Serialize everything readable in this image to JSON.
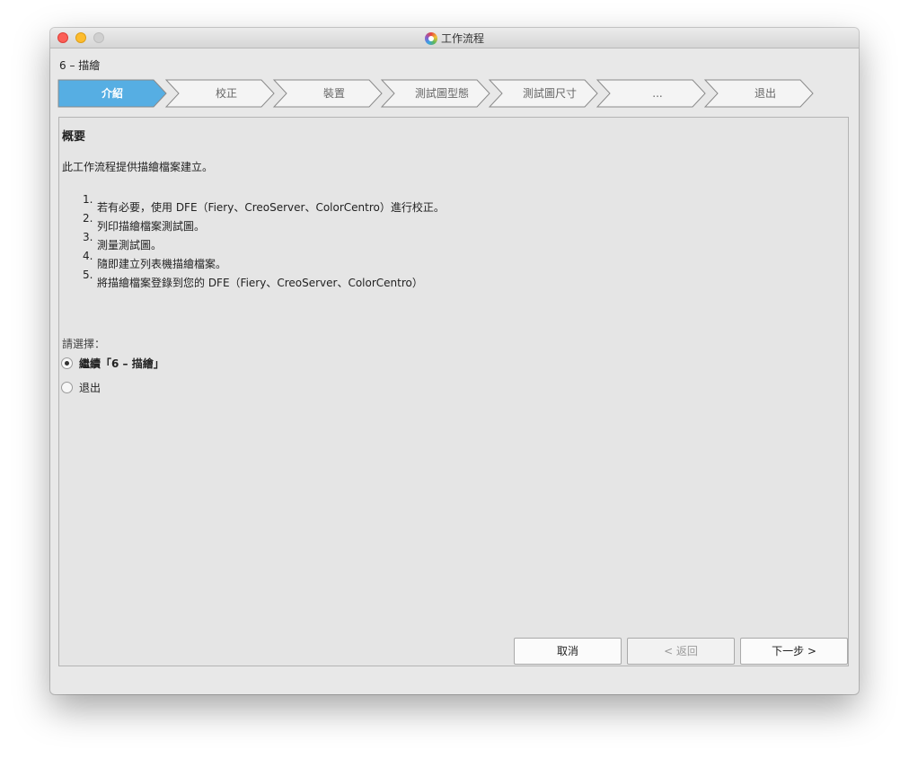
{
  "window": {
    "title": "工作流程"
  },
  "subtitle": "6 – 描繪",
  "steps": [
    {
      "label": "介紹",
      "active": true
    },
    {
      "label": "校正",
      "active": false
    },
    {
      "label": "裝置",
      "active": false
    },
    {
      "label": "測試圖型態",
      "active": false
    },
    {
      "label": "測試圖尺寸",
      "active": false
    },
    {
      "label": "...",
      "active": false
    },
    {
      "label": "退出",
      "active": false
    }
  ],
  "content": {
    "heading": "概要",
    "description": "此工作流程提供描繪檔案建立。",
    "list": [
      {
        "num": "1.",
        "text": "若有必要，使用 DFE（Fiery、CreoServer、ColorCentro）進行校正。"
      },
      {
        "num": "2.",
        "text": "列印描繪檔案測試圖。"
      },
      {
        "num": "3.",
        "text": "測量測試圖。"
      },
      {
        "num": "4.",
        "text": "隨即建立列表機描繪檔案。"
      },
      {
        "num": "5.",
        "text": "將描繪檔案登錄到您的 DFE（Fiery、CreoServer、ColorCentro）"
      }
    ],
    "choose_label": "請選擇：",
    "options": [
      {
        "label": "繼續「6 – 描繪」",
        "checked": true
      },
      {
        "label": "退出",
        "checked": false
      }
    ]
  },
  "buttons": {
    "cancel": "取消",
    "back": "< 返回",
    "next": "下一步 >"
  },
  "colors": {
    "active_step": "#56aee3",
    "inactive_step": "#f4f4f4"
  }
}
